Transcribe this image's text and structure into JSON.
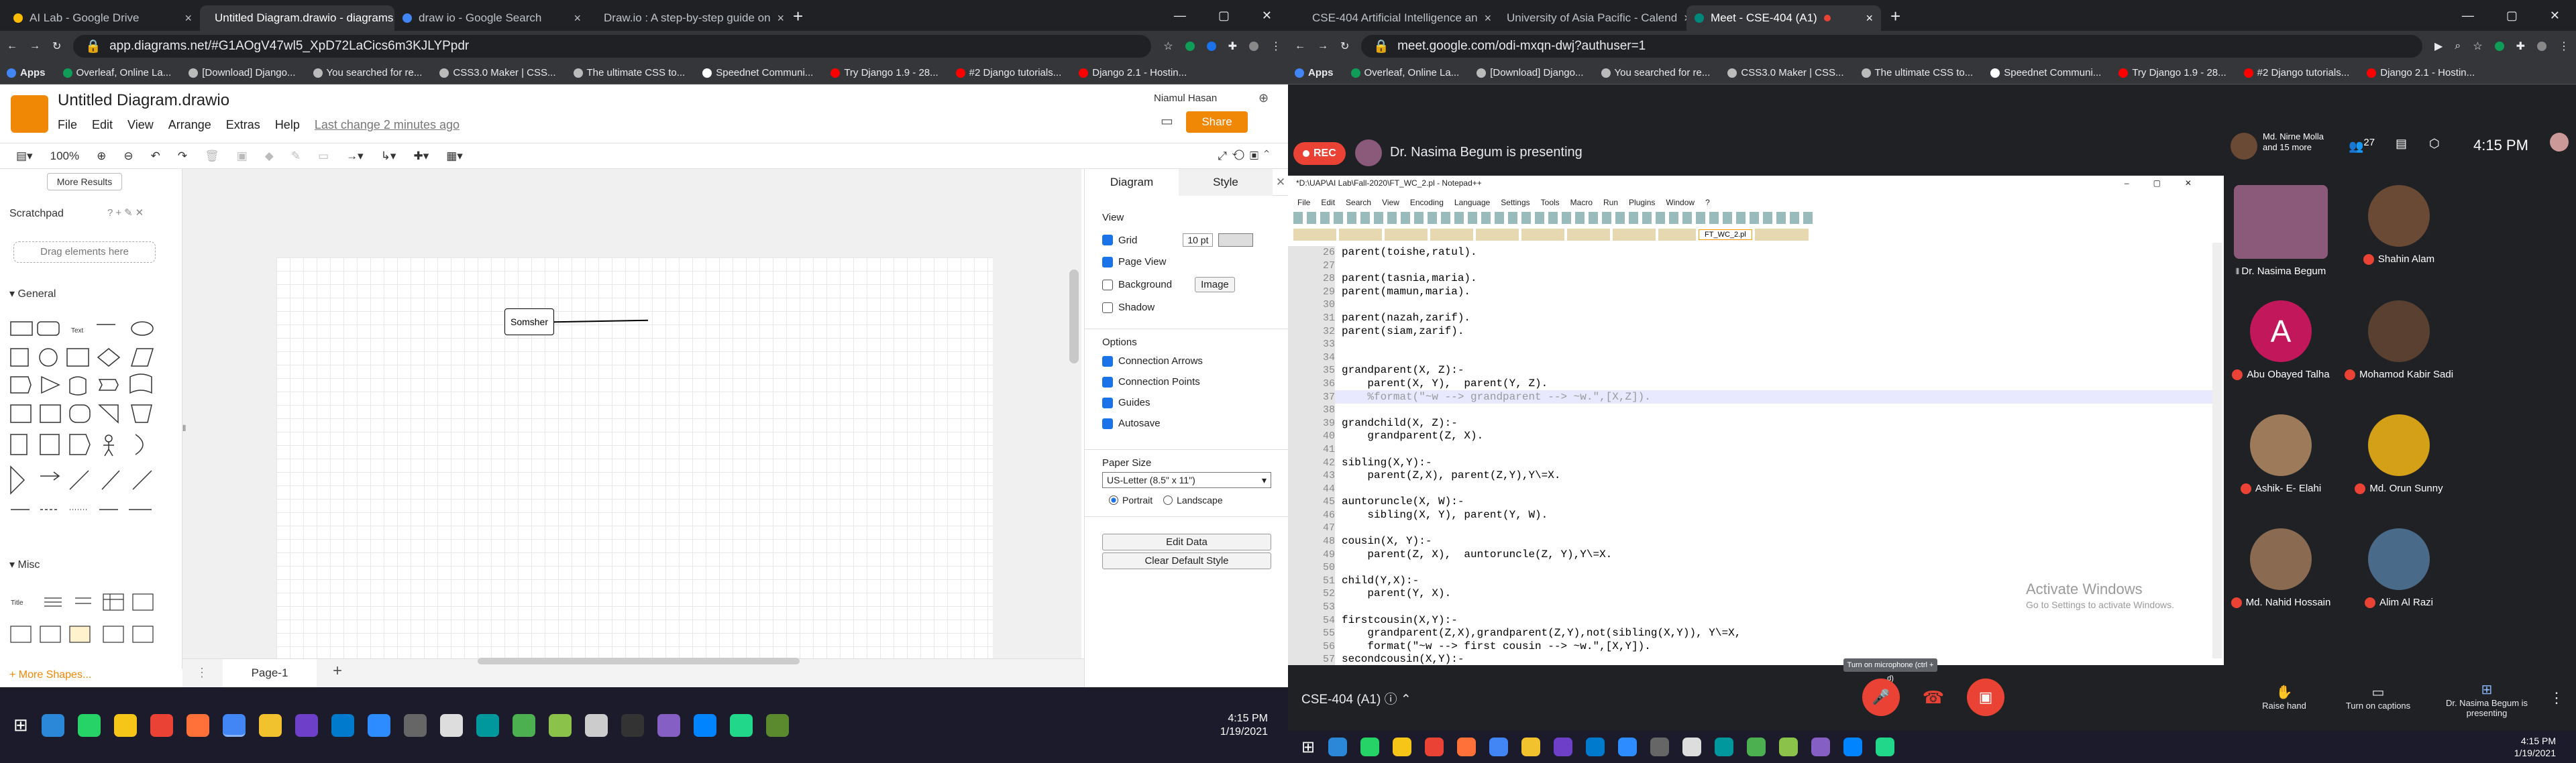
{
  "left_browser": {
    "tabs": [
      {
        "title": "AI Lab - Google Drive"
      },
      {
        "title": "Untitled Diagram.drawio - diagrams.net",
        "active": true
      },
      {
        "title": "draw io - Google Search"
      },
      {
        "title": "Draw.io : A step-by-step guide on"
      }
    ],
    "url": "app.diagrams.net/#G1AOgV47wl5_XpD72LaCics6m3KJLYPpdr",
    "bookmarks": [
      "Apps",
      "Overleaf, Online La...",
      "[Download] Django...",
      "You searched for re...",
      "CSS3.0 Maker | CSS...",
      "The ultimate CSS to...",
      "Speednet Communi...",
      "Try Django 1.9 - 28...",
      "#2 Django tutorials...",
      "Django 2.1 - Hostin..."
    ]
  },
  "drawio": {
    "title": "Untitled Diagram.drawio",
    "menu": [
      "File",
      "Edit",
      "View",
      "Arrange",
      "Extras",
      "Help"
    ],
    "last_change": "Last change 2 minutes ago",
    "user": "Niamul Hasan",
    "share_label": "Share",
    "zoom": "100%",
    "more_results": "More Results",
    "scratchpad": "Scratchpad",
    "drag_hint": "Drag elements here",
    "general": "General",
    "misc": "Misc",
    "more_shapes": "+ More Shapes...",
    "shape_box": "Somsher",
    "page_tab": "Page-1",
    "panel_tabs": [
      "Diagram",
      "Style"
    ],
    "view_label": "View",
    "grid_label": "Grid",
    "grid_size": "10 pt",
    "page_view_label": "Page View",
    "background_label": "Background",
    "image_btn": "Image",
    "shadow_label": "Shadow",
    "options_label": "Options",
    "options": [
      "Connection Arrows",
      "Connection Points",
      "Guides",
      "Autosave"
    ],
    "paper_size_label": "Paper Size",
    "paper_size": "US-Letter (8.5\" x 11\")",
    "portrait": "Portrait",
    "landscape": "Landscape",
    "edit_data": "Edit Data",
    "clear_style": "Clear Default Style"
  },
  "right_browser": {
    "tabs": [
      {
        "title": "CSE-404 Artificial Intelligence an"
      },
      {
        "title": "University of Asia Pacific - Calend"
      },
      {
        "title": "Meet - CSE-404 (A1)",
        "active": true
      }
    ],
    "url": "meet.google.com/odi-mxqn-dwj?authuser=1",
    "bookmarks": [
      "Apps",
      "Overleaf, Online La...",
      "[Download] Django...",
      "You searched for re...",
      "CSS3.0 Maker | CSS...",
      "The ultimate CSS to...",
      "Speednet Communi...",
      "Try Django 1.9 - 28...",
      "#2 Django tutorials...",
      "Django 2.1 - Hostin..."
    ],
    "rec": "REC",
    "presenting": "Dr. Nasima Begum is presenting",
    "top_participant": "Md. Nirne Molla and 15 more",
    "people_count": "27",
    "time": "4:15 PM",
    "meeting": "CSE-404 (A1)",
    "raise_hand": "Raise hand",
    "captions": "Turn on captions",
    "presenter_label": "Dr. Nasima Begum is presenting",
    "mic_tooltip": "Turn on microphone (ctrl + d)"
  },
  "notepad": {
    "title": "*D:\\UAP\\AI Lab\\Fall-2020\\FT_WC_2.pl - Notepad++",
    "menu": [
      "File",
      "Edit",
      "Search",
      "View",
      "Encoding",
      "Language",
      "Settings",
      "Tools",
      "Macro",
      "Run",
      "Plugins",
      "Window",
      "?"
    ],
    "active_tab": "FT_WC_2.pl",
    "line_numbers": [
      "26",
      "27",
      "28",
      "29",
      "30",
      "31",
      "32",
      "33",
      "34",
      "35",
      "36",
      "37",
      "38",
      "39",
      "40",
      "41",
      "42",
      "43",
      "44",
      "45",
      "46",
      "47",
      "48",
      "49",
      "50",
      "51",
      "52",
      "53",
      "54",
      "55",
      "56",
      "57"
    ],
    "lines": [
      "parent(toishe,ratul).",
      "",
      "parent(tasnia,maria).",
      "parent(mamun,maria).",
      "",
      "parent(nazah,zarif).",
      "parent(siam,zarif).",
      "",
      "",
      "grandparent(X, Z):-",
      "    parent(X, Y),  parent(Y, Z).",
      "    %format(\"~w --> grandparent --> ~w.\",[X,Z]).",
      "",
      "grandchild(X, Z):-",
      "    grandparent(Z, X).",
      "",
      "sibling(X,Y):-",
      "    parent(Z,X), parent(Z,Y),Y\\=X.",
      "",
      "auntoruncle(X, W):-",
      "    sibling(X, Y), parent(Y, W).",
      "",
      "cousin(X, Y):-",
      "    parent(Z, X),  auntoruncle(Z, Y),Y\\=X.",
      "",
      "child(Y,X):-",
      "    parent(Y, X).",
      "",
      "firstcousin(X,Y):-",
      "    grandparent(Z,X),grandparent(Z,Y),not(sibling(X,Y)), Y\\=X,",
      "    format(\"~w --> first cousin --> ~w.\",[X,Y]).",
      "secondcousin(X,Y):-"
    ],
    "watermark_1": "Activate Windows",
    "watermark_2": "Go to Settings to activate Windows."
  },
  "participants": [
    {
      "name": "Dr. Nasima Begum",
      "color": "#8b5a7a"
    },
    {
      "name": "Shahin Alam",
      "color": "#6b4a35"
    },
    {
      "name": "Abu Obayed Talha",
      "letter": "A",
      "color": "#c2185b"
    },
    {
      "name": "Mohamod Kabir Sadi",
      "color": "#5a4030"
    },
    {
      "name": "Ashik- E- Elahi",
      "color": "#9c7a5a"
    },
    {
      "name": "Md. Orun Sunny",
      "color": "#d4a017"
    },
    {
      "name": "Md. Nahid Hossain",
      "color": "#8a6a50"
    },
    {
      "name": "Alim Al Razi",
      "color": "#4a6a8a"
    }
  ],
  "taskbar_left": {
    "time": "4:15 PM",
    "date": "1/19/2021"
  },
  "taskbar_right": {
    "time": "4:15 PM",
    "date": "1/19/2021"
  }
}
